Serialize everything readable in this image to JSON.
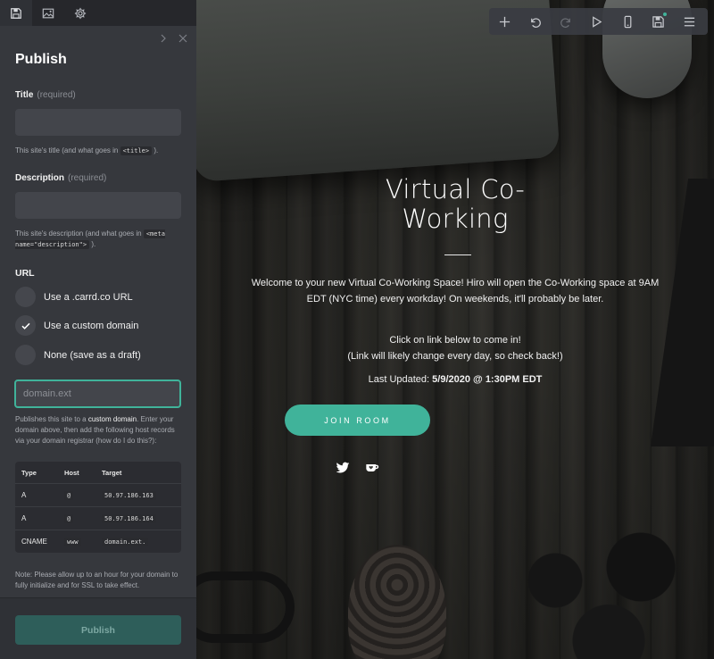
{
  "panel": {
    "tabs": [
      {
        "icon": "save-icon"
      },
      {
        "icon": "image-icon"
      },
      {
        "icon": "gear-icon"
      }
    ],
    "title": "Publish",
    "title_field": {
      "label": "Title",
      "required": "(required)",
      "value": "",
      "hint_before": "This site's title (and what goes in",
      "hint_code": "<title>",
      "hint_after": ")."
    },
    "description_field": {
      "label": "Description",
      "required": "(required)",
      "value": "",
      "hint_before": "This site's description (and what goes in",
      "hint_code": "<meta name=\"description\">",
      "hint_after": ")."
    },
    "url": {
      "label": "URL",
      "options": [
        {
          "label": "Use a .carrd.co URL",
          "selected": false
        },
        {
          "label": "Use a custom domain",
          "selected": true
        },
        {
          "label": "None (save as a draft)",
          "selected": false
        }
      ],
      "domain_placeholder": "domain.ext",
      "domain_hint_before": "Publishes this site to a",
      "domain_hint_strong": "custom domain",
      "domain_hint_after": ". Enter your domain above, then add the following host records via your domain registrar (how do I do this?):"
    },
    "records": {
      "headers": [
        "Type",
        "Host",
        "Target"
      ],
      "rows": [
        {
          "type": "A",
          "host": "@",
          "target": "50.97.186.163"
        },
        {
          "type": "A",
          "host": "@",
          "target": "50.97.186.164"
        },
        {
          "type": "CNAME",
          "host": "www",
          "target": "domain.ext."
        }
      ]
    },
    "note": "Note: Please allow up to an hour for your domain to fully initialize and for SSL to take effect.",
    "publish_label": "Publish"
  },
  "toolbar": {
    "buttons": [
      "add-icon",
      "undo-icon",
      "redo-icon",
      "play-icon",
      "mobile-icon",
      "save-icon",
      "menu-icon"
    ]
  },
  "hero": {
    "title_line1": "Virtual Co-",
    "title_line2": "Working",
    "p1": "Welcome to your new Virtual Co-Working Space! Hiro will open the Co-Working space at 9AM EDT (NYC time) every workday! On weekends, it'll probably be later.",
    "p2_line1": "Click on link below to come in!",
    "p2_line2": "(Link will likely change every day, so check back!)",
    "updated_label": "Last Updated:",
    "updated_value": "5/9/2020 @ 1:30PM EDT",
    "button": "JOIN ROOM",
    "colors": {
      "accent": "#40b39a",
      "panel": "#36383d",
      "text": "#ffffff"
    }
  }
}
